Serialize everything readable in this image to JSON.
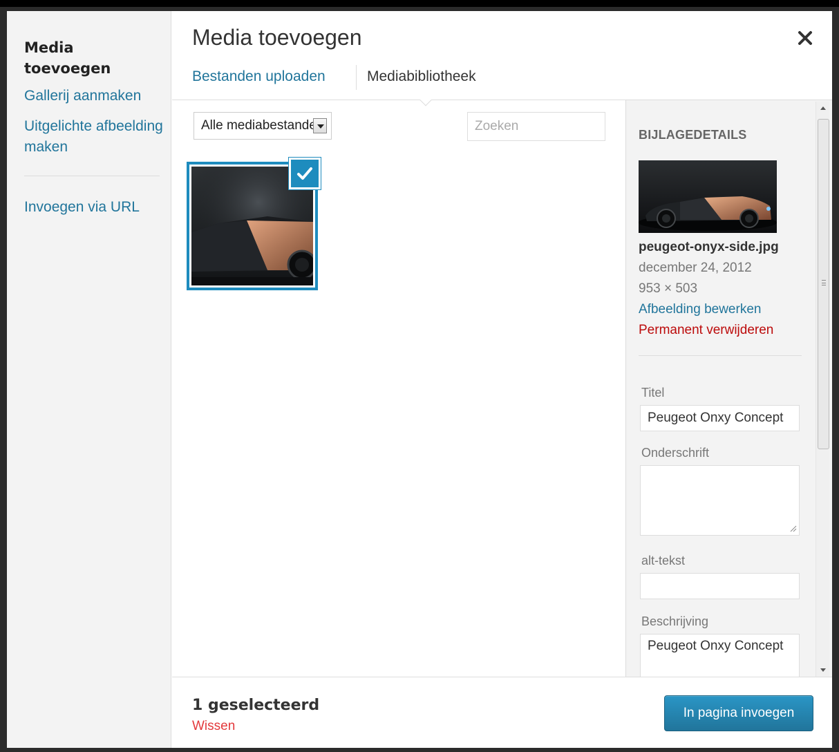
{
  "sidebar": {
    "heading": "Media toevoegen",
    "items": [
      {
        "label": "Gallerij aanmaken"
      },
      {
        "label": "Uitgelichte afbeelding maken"
      },
      {
        "label": "Invoegen via URL"
      }
    ]
  },
  "header": {
    "title": "Media toevoegen",
    "close_icon": "close-icon",
    "tabs": [
      {
        "label": "Bestanden uploaden",
        "active": false
      },
      {
        "label": "Mediabibliotheek",
        "active": true
      }
    ]
  },
  "toolbar": {
    "filter_value": "Alle mediabestanden",
    "search_placeholder": "Zoeken"
  },
  "library": {
    "items": [
      {
        "selected": true,
        "check_icon": "checkmark-icon"
      }
    ]
  },
  "details": {
    "title": "Bijlagedetails",
    "filename": "peugeot-onyx-side.jpg",
    "date": "december 24, 2012",
    "dimensions": "953 × 503",
    "edit_label": "Afbeelding bewerken",
    "delete_label": "Permanent verwijderen",
    "fields": {
      "title_label": "Titel",
      "title_value": "Peugeot Onxy Concept",
      "caption_label": "Onderschrift",
      "caption_value": "",
      "alt_label": "alt-tekst",
      "alt_value": "",
      "description_label": "Beschrijving",
      "description_value": "Peugeot Onxy Concept"
    }
  },
  "footer": {
    "selected_count": "1 geselecteerd",
    "clear_label": "Wissen",
    "insert_label": "In pagina invoegen"
  },
  "colors": {
    "accent": "#1e8cbe",
    "link": "#21759b",
    "danger": "#bc0b0b",
    "clear": "#e3393c"
  }
}
